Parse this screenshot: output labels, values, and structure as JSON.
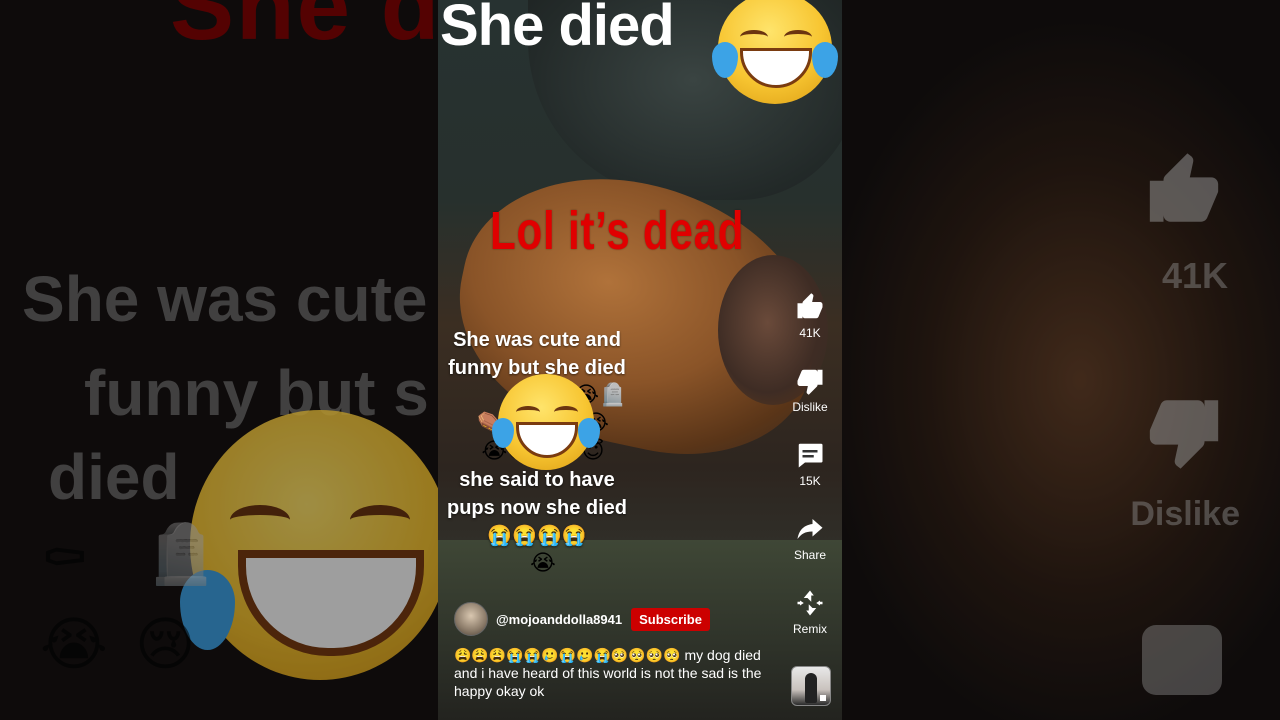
{
  "background": {
    "title_text": "She died",
    "caption_line1": "She was cute",
    "caption_line2": "funny but s",
    "caption_line3": "died",
    "like_count": "41K",
    "dislike_label": "Dislike"
  },
  "video": {
    "top_title": "She died",
    "red_caption": "Lol it’s dead",
    "caption_main": "She was cute and funny but she died",
    "caption_emoji_row1": "🪦😭🪦",
    "caption_emoji_row2": "⚰️🪦😭😭😭",
    "caption_emoji_row3": "😭😢😭😭😇",
    "caption_second": "she said to have pups now she died😭😭😭😭",
    "caption_emoji_row4": "😭"
  },
  "actions": {
    "like_label": "41K",
    "dislike_label": "Dislike",
    "comments_label": "15K",
    "share_label": "Share",
    "remix_label": "Remix"
  },
  "channel": {
    "handle": "@mojoanddolla8941",
    "subscribe_label": "Subscribe"
  },
  "description": {
    "text": "😩😩😩😭😭🥲😭🥲😭🥺🥺🥺🥺 my dog died and i have heard of this world is not the sad is the happy okay ok"
  },
  "icons": [
    "thumb-up-icon",
    "thumb-down-icon",
    "comment-icon",
    "share-icon",
    "remix-icon"
  ]
}
